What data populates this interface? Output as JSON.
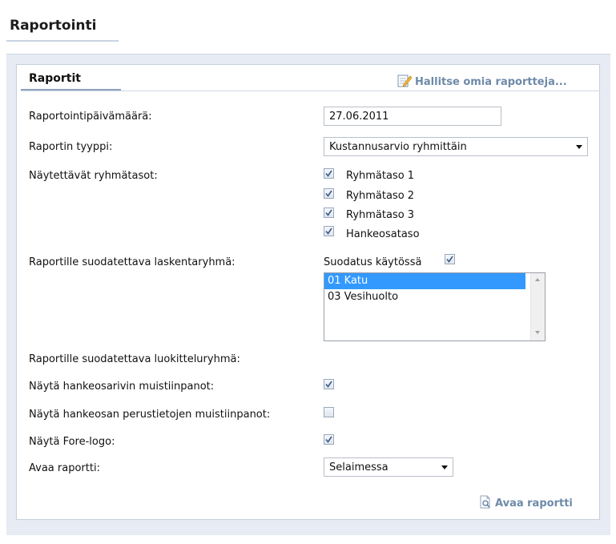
{
  "page": {
    "title": "Raportointi"
  },
  "panel": {
    "title": "Raportit",
    "manage_link": "Hallitse omia raportteja..."
  },
  "fields": {
    "date": {
      "label": "Raportointipäivämäärä:",
      "value": "27.06.2011"
    },
    "type": {
      "label": "Raportin tyyppi:",
      "value": "Kustannusarvio ryhmittäin"
    },
    "levels": {
      "label": "Näytettävät ryhmätasot:",
      "options": [
        {
          "label": "Ryhmätaso 1",
          "checked": true
        },
        {
          "label": "Ryhmätaso 2",
          "checked": true
        },
        {
          "label": "Ryhmätaso 3",
          "checked": true
        },
        {
          "label": "Hankeosataso",
          "checked": true
        }
      ]
    },
    "calc_group": {
      "label": "Raportille suodatettava laskentaryhmä:",
      "filter_label": "Suodatus käytössä",
      "filter_checked": true,
      "items": [
        {
          "label": "01 Katu",
          "selected": true
        },
        {
          "label": "03 Vesihuolto",
          "selected": false
        }
      ]
    },
    "class_group": {
      "label": "Raportille suodatettava luokitteluryhmä:"
    },
    "row_notes": {
      "label": "Näytä hankeosarivin muistiinpanot:",
      "checked": true
    },
    "base_notes": {
      "label": "Näytä hankeosan perustietojen muistiinpanot:",
      "checked": false
    },
    "fore_logo": {
      "label": "Näytä Fore-logo:",
      "checked": true
    },
    "open_in": {
      "label": "Avaa raportti:",
      "value": "Selaimessa"
    }
  },
  "actions": {
    "open_report": "Avaa raportti"
  },
  "colors": {
    "accent_link": "#6e8aa9",
    "selection": "#3399ff",
    "background": "#e6ebf4"
  }
}
